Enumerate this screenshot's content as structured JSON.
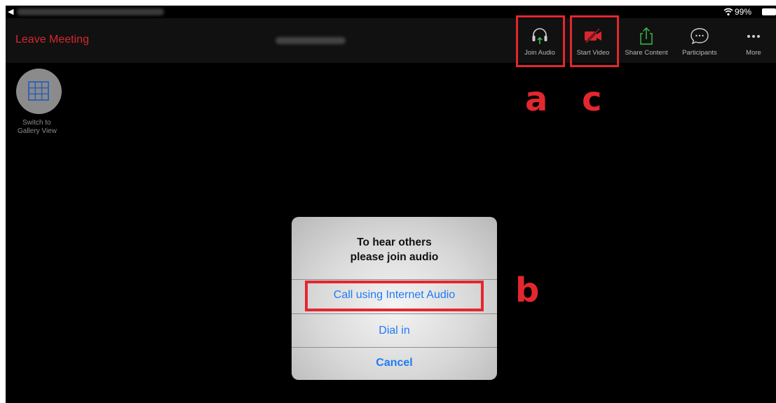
{
  "status_bar": {
    "battery_percent": "99%",
    "wifi_icon": "wifi-icon",
    "battery_icon": "battery-icon"
  },
  "toolbar": {
    "leave_label": "Leave Meeting",
    "items": [
      {
        "label": "Join Audio",
        "icon": "headphones-icon"
      },
      {
        "label": "Start Video",
        "icon": "video-camera-off-icon"
      },
      {
        "label": "Share Content",
        "icon": "share-icon"
      },
      {
        "label": "Participants",
        "icon": "chat-bubble-icon"
      },
      {
        "label": "More",
        "icon": "more-dots-icon"
      }
    ]
  },
  "gallery": {
    "label_line1": "Switch to",
    "label_line2": "Gallery View",
    "icon": "grid-icon"
  },
  "dialog": {
    "title_line1": "To hear others",
    "title_line2": "please join audio",
    "internet_audio": "Call using Internet Audio",
    "dial_in": "Dial in",
    "cancel": "Cancel"
  },
  "annotations": {
    "a": "a",
    "b": "b",
    "c": "c",
    "color": "#e3272e"
  },
  "colors": {
    "leave": "#d8262e",
    "link": "#1f7bf5",
    "share_green": "#3cbf4a"
  }
}
